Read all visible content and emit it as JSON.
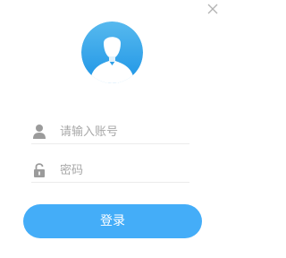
{
  "close": {
    "icon": "close-icon"
  },
  "avatar": {
    "icon": "user-avatar-icon",
    "gradient_top": "#57b9ee",
    "gradient_bottom": "#1e95e6"
  },
  "account": {
    "icon": "user-icon",
    "value": "",
    "placeholder": "请输入账号"
  },
  "password": {
    "icon": "lock-icon",
    "value": "",
    "placeholder": "密码"
  },
  "login": {
    "label": "登录",
    "color": "#44adf8"
  }
}
